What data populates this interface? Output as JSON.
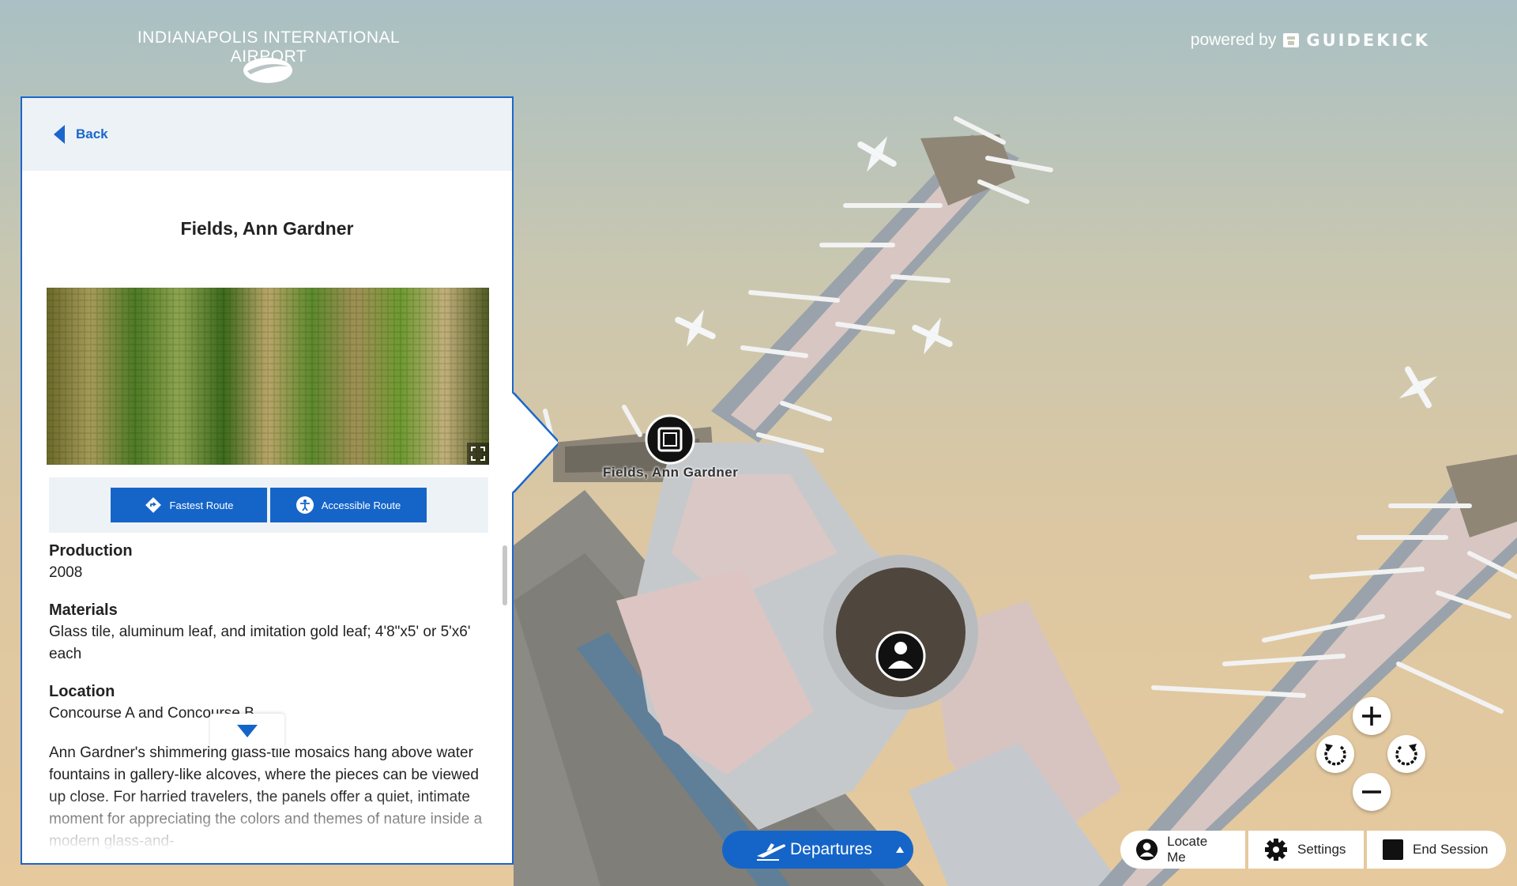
{
  "header": {
    "airport_name": "INDIANAPOLIS INTERNATIONAL AIRPORT",
    "powered_by": "powered by",
    "brand": "GUIDEKICK"
  },
  "panel": {
    "back_label": "Back",
    "title": "Fields, Ann Gardner",
    "fastest_route": "Fastest Route",
    "accessible_route": "Accessible Route",
    "production_label": "Production",
    "production_value": "2008",
    "materials_label": "Materials",
    "materials_value": "Glass tile, aluminum leaf, and imitation gold leaf; 4'8\"x5' or 5'x6' each",
    "location_label": "Location",
    "location_value": "Concourse A and Concourse B",
    "description": "Ann Gardner's shimmering glass-tile mosaics hang above water fountains in gallery-like alcoves, where the pieces can be viewed up close. For harried travelers, the panels offer a quiet, intimate moment for appreciating the colors and themes of nature inside a modern glass-and-"
  },
  "map": {
    "poi_label": "Fields, Ann Gardner"
  },
  "controls": {
    "departures": "Departures",
    "locate_me": "Locate Me",
    "settings": "Settings",
    "end_session": "End Session"
  },
  "colors": {
    "accent": "#1565c9",
    "panel_border": "#1a66cc"
  }
}
